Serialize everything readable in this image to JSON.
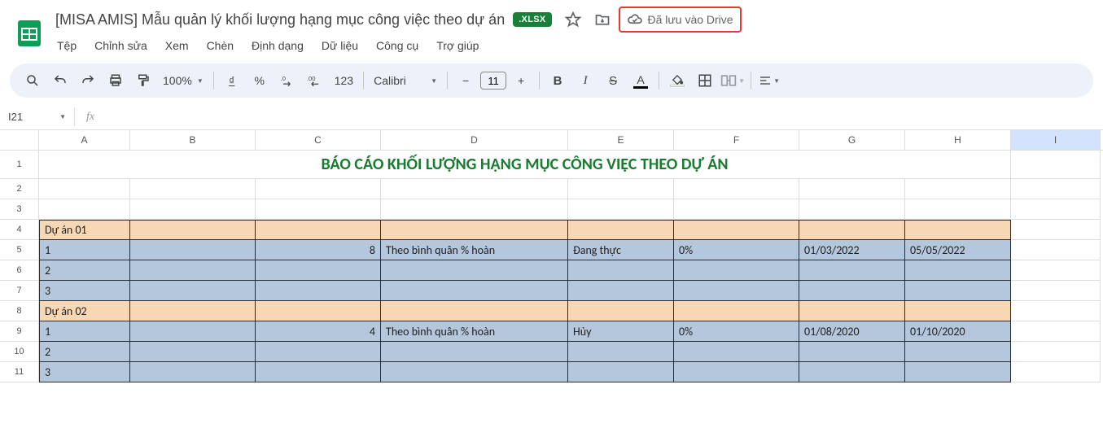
{
  "title": "[MISA AMIS] Mẫu quản lý khối lượng hạng mục công việc theo dự án",
  "file_badge": ".XLSX",
  "save_status": "Đã lưu vào Drive",
  "menus": [
    "Tệp",
    "Chỉnh sửa",
    "Xem",
    "Chèn",
    "Định dạng",
    "Dữ liệu",
    "Công cụ",
    "Trợ giúp"
  ],
  "toolbar": {
    "zoom": "100%",
    "currency": "₫",
    "percent": "%",
    "dec_dec": ".0←",
    "dec_inc": ".00→",
    "num_fmt": "123",
    "font": "Calibri",
    "font_size": "11",
    "bold": "B",
    "italic": "I",
    "strike": "S",
    "text_color": "A"
  },
  "name_box": "I21",
  "columns": [
    "A",
    "B",
    "C",
    "D",
    "E",
    "F",
    "G",
    "H",
    "I"
  ],
  "sheet": {
    "title": "BÁO CÁO KHỐI LƯỢNG HẠNG MỤC CÔNG VIỆC THEO DỰ ÁN",
    "rows": [
      {
        "n": 1,
        "type": "title"
      },
      {
        "n": 2,
        "type": "blank"
      },
      {
        "n": 3,
        "type": "blank"
      },
      {
        "n": 4,
        "type": "project",
        "A": "Dự án 01"
      },
      {
        "n": 5,
        "type": "data",
        "A": "1",
        "C": "8",
        "D": "Theo bình quân % hoàn",
        "E": "Đang thực",
        "F": "0%",
        "G": "01/03/2022",
        "H": "05/05/2022"
      },
      {
        "n": 6,
        "type": "data",
        "A": "2"
      },
      {
        "n": 7,
        "type": "data",
        "A": "3"
      },
      {
        "n": 8,
        "type": "project",
        "A": "Dự án 02"
      },
      {
        "n": 9,
        "type": "data",
        "A": "1",
        "C": "4",
        "D": "Theo bình quân % hoàn",
        "E": "Hủy",
        "F": "0%",
        "G": "01/08/2020",
        "H": "01/10/2020"
      },
      {
        "n": 10,
        "type": "data",
        "A": "2"
      },
      {
        "n": 11,
        "type": "data",
        "A": "3"
      }
    ]
  }
}
